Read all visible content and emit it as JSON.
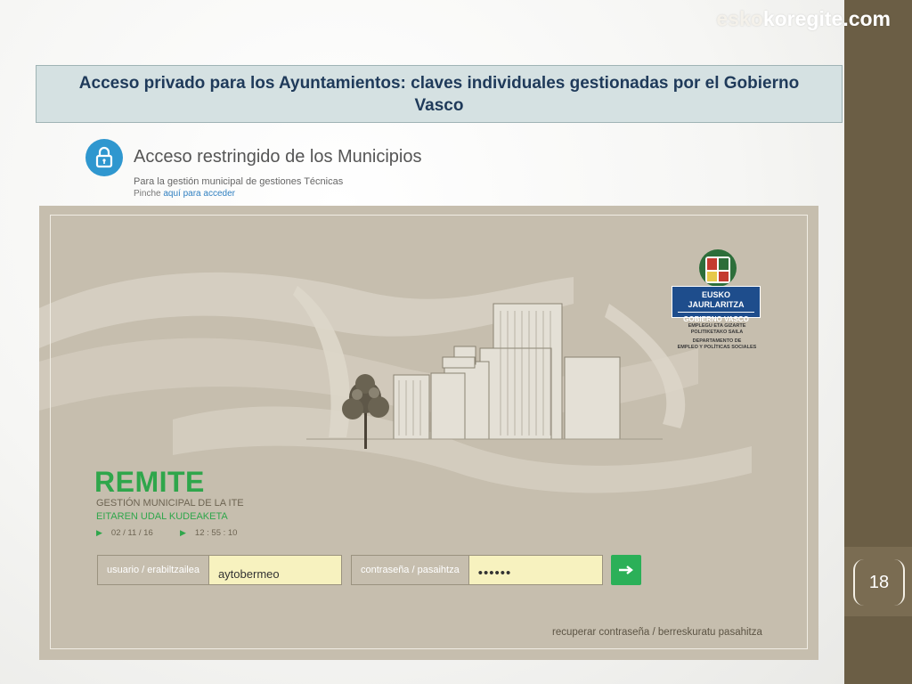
{
  "watermark": {
    "faded": "esko",
    "text": "koregite",
    "suffix": ".com"
  },
  "title": "Acceso privado para los Ayuntamientos: claves individuales gestionadas por el Gobierno Vasco",
  "restricted": {
    "heading": "Acceso restringido de los Municipios",
    "subtitle": "Para la gestión municipal de gestiones Técnicas",
    "click_prefix": "Pinche",
    "click_link": "aquí para acceder",
    "icon": "lock-icon",
    "icon_color": "#2f97cf"
  },
  "app": {
    "logo": {
      "plate_line1": "EUSKO JAURLARITZA",
      "plate_line2": "GOBIERNO VASCO",
      "dept_eu_1": "EMPLEGU ETA GIZARTE",
      "dept_eu_2": "POLITIKETAKO SAILA",
      "dept_es_1": "DEPARTAMENTO DE",
      "dept_es_2": "EMPLEO Y POLÍTICAS SOCIALES"
    },
    "name": "REMITE",
    "subtitle_es": "GESTIÓN MUNICIPAL DE LA ITE",
    "subtitle_eu": "EITAREN UDAL KUDEAKETA",
    "date": "02 / 11 / 16",
    "time": "12 : 55 : 10",
    "username_label": "usuario / erabiltzailea",
    "username_value": "aytobermeo",
    "password_label": "contraseña / pasaihtza",
    "password_value": "••••••",
    "submit_icon": "arrow-right-icon",
    "recover_link": "recuperar contraseña / berreskuratu pasahitza",
    "accent_color": "#2fa64b"
  },
  "page_number": "18"
}
